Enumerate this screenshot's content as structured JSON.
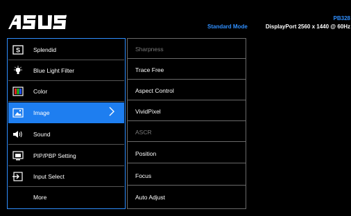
{
  "header": {
    "logo_text": "ASUS",
    "model": "PB328",
    "mode": "Standard Mode",
    "source": "DisplayPort 2560 x 1440 @ 60Hz",
    "accent_color": "#2f8fff"
  },
  "left_menu": {
    "items": [
      {
        "label": "Splendid",
        "icon": "splendid-s-icon"
      },
      {
        "label": "Blue Light Filter",
        "icon": "blue-light-bulb-icon"
      },
      {
        "label": "Color",
        "icon": "color-bars-icon"
      },
      {
        "label": "Image",
        "icon": "image-picture-icon",
        "selected": true
      },
      {
        "label": "Sound",
        "icon": "speaker-icon"
      },
      {
        "label": "PIP/PBP Setting",
        "icon": "pip-screen-icon"
      },
      {
        "label": "Input Select",
        "icon": "input-arrow-icon"
      },
      {
        "label": "More",
        "icon": ""
      }
    ]
  },
  "right_menu": {
    "items": [
      {
        "label": "Sharpness",
        "enabled": false
      },
      {
        "label": "Trace Free",
        "enabled": true
      },
      {
        "label": "Aspect Control",
        "enabled": true
      },
      {
        "label": "VividPixel",
        "enabled": true
      },
      {
        "label": "ASCR",
        "enabled": false
      },
      {
        "label": "Position",
        "enabled": true
      },
      {
        "label": "Focus",
        "enabled": true
      },
      {
        "label": "Auto Adjust",
        "enabled": true
      }
    ]
  }
}
